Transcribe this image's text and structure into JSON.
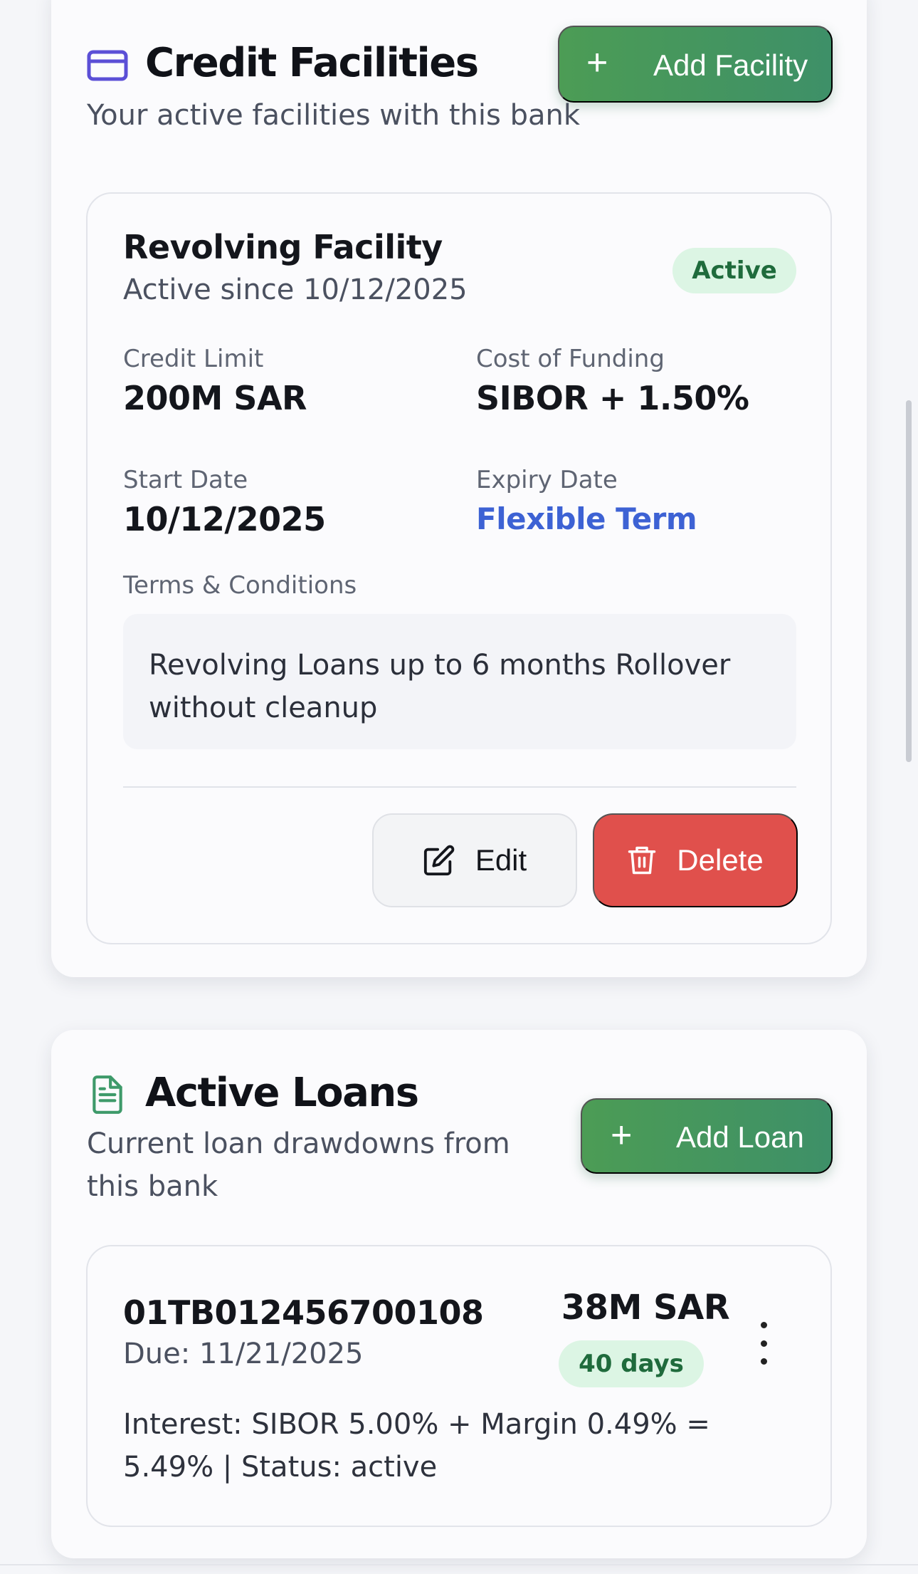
{
  "facilities": {
    "icon": "credit-card-icon",
    "title": "Credit Facilities",
    "subtitle": "Your active facilities with this bank",
    "add_label": "Add Facility",
    "accent": "#5b4fd6",
    "item": {
      "title": "Revolving Facility",
      "since": "Active since 10/12/2025",
      "status": "Active",
      "credit_limit_label": "Credit Limit",
      "credit_limit": "200M SAR",
      "cost_label": "Cost of Funding",
      "cost": "SIBOR + 1.50%",
      "start_label": "Start Date",
      "start": "10/12/2025",
      "expiry_label": "Expiry Date",
      "expiry": "Flexible Term",
      "terms_label": "Terms & Conditions",
      "terms": "Revolving Loans up to 6 months Rollover without cleanup",
      "edit_label": "Edit",
      "delete_label": "Delete"
    }
  },
  "loans": {
    "icon": "document-icon",
    "title": "Active Loans",
    "subtitle": "Current loan drawdowns from this bank",
    "add_label": "Add Loan",
    "items": [
      {
        "id": "01TB012456700108",
        "due": "Due: 11/21/2025",
        "amount": "38M SAR",
        "days": "40 days",
        "interest": "Interest: SIBOR 5.00% + Margin 0.49% = 5.49% | Status: active"
      }
    ]
  },
  "colors": {
    "primary_green": "#4c9c55",
    "danger_red": "#e0504c",
    "link_blue": "#3d62d4",
    "badge_green_bg": "#dcf5e4",
    "badge_green_text": "#1f6b3c"
  }
}
